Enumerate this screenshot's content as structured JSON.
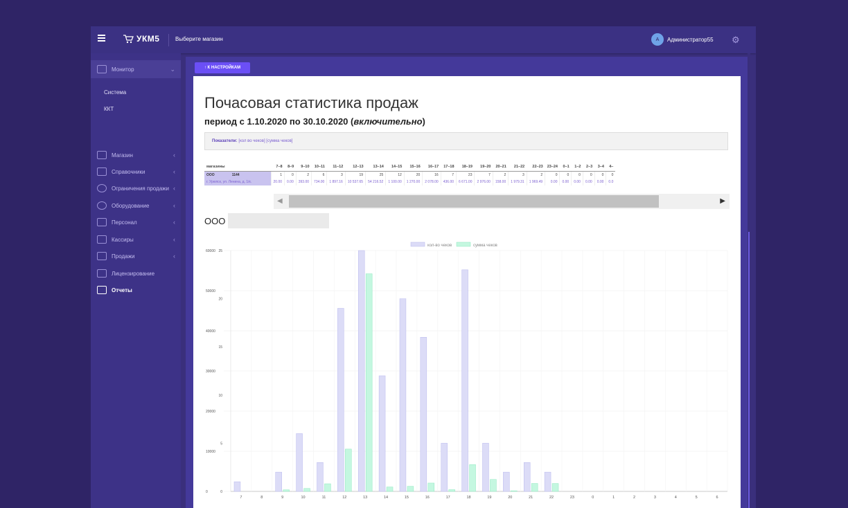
{
  "app": {
    "logo_text": "УКМ5",
    "shop_select": "Выберите магазин",
    "user": "Администратор55",
    "avatar_letter": "A"
  },
  "sidebar": {
    "items": [
      {
        "label": "Монитор",
        "icon": "grid-icon"
      },
      {
        "label": "Магазин",
        "icon": "shop-icon"
      },
      {
        "label": "Справочники",
        "icon": "list-icon"
      },
      {
        "label": "Ограничения продажи",
        "icon": "restrict-icon"
      },
      {
        "label": "Оборудование",
        "icon": "gear-icon"
      },
      {
        "label": "Персонал",
        "icon": "user-icon"
      },
      {
        "label": "Кассиры",
        "icon": "dots-grid-icon"
      },
      {
        "label": "Продажи",
        "icon": "bar-chart-icon"
      },
      {
        "label": "Лицензирование",
        "icon": "lock-icon"
      },
      {
        "label": "Отчеты",
        "icon": "edit-icon"
      }
    ],
    "monitor_sub": [
      "Система",
      "ККТ"
    ]
  },
  "toolbar": {
    "back_label": "К НАСТРОЙКАМ"
  },
  "report": {
    "title": "Почасовая статистика продаж",
    "period_prefix": "период с 1.10.2020 по 30.10.2020 (",
    "period_em": "включительно",
    "period_suffix": ")",
    "indicators_label": "Показатели:",
    "indicators_value": "[кол во чеков] [сумма чеков]",
    "org_name": "ООО"
  },
  "table": {
    "shop_header": "магазины",
    "hours": [
      "7–8",
      "8–9",
      "9–10",
      "10–11",
      "11–12",
      "12–13",
      "13–14",
      "14–15",
      "15–16",
      "16–17",
      "17–18",
      "18–19",
      "19–20",
      "20–21",
      "21–22",
      "22–23",
      "23–24",
      "0–1",
      "1–2",
      "2–3",
      "3–4",
      "4–"
    ],
    "shop_name": "ООО",
    "shop_code": "1144",
    "shop_address": "г. Урюпск, ул. Ленина, д. 1/к.",
    "counts": [
      "1",
      "0",
      "2",
      "6",
      "3",
      "19",
      "25",
      "12",
      "20",
      "16",
      "7",
      "23",
      "7",
      "2",
      "3",
      "2",
      "0",
      "0",
      "0",
      "0",
      "0",
      "0"
    ],
    "sums": [
      "20.00",
      "0.00",
      "393.00",
      "734.00",
      "1 897.16",
      "10 537.65",
      "54 216.52",
      "1 100.00",
      "1 270.00",
      "2 078.00",
      "436.00",
      "6 671.00",
      "2 976.00",
      "158.00",
      "1 979.31",
      "1 969.49",
      "0.00",
      "0.00",
      "0.00",
      "0.00",
      "0.00",
      "0.0"
    ]
  },
  "chart_data": {
    "type": "bar",
    "legend": [
      "кол-во чеков",
      "сумма чеков"
    ],
    "legend_position": "top",
    "categories": [
      "7",
      "8",
      "9",
      "10",
      "11",
      "12",
      "13",
      "14",
      "15",
      "16",
      "17",
      "18",
      "19",
      "20",
      "21",
      "22",
      "23",
      "0",
      "1",
      "2",
      "3",
      "4",
      "5",
      "6"
    ],
    "series": [
      {
        "name": "кол-во чеков",
        "axis": "right",
        "values": [
          1,
          0,
          2,
          6,
          3,
          19,
          25,
          12,
          20,
          16,
          5,
          23,
          5,
          2,
          3,
          2,
          0,
          0,
          0,
          0,
          0,
          0,
          0,
          0
        ]
      },
      {
        "name": "сумма чеков",
        "axis": "left",
        "values": [
          0,
          0,
          393,
          734,
          1897,
          10538,
          54217,
          1100,
          1270,
          2078,
          436,
          6671,
          2976,
          158,
          1979,
          1969,
          0,
          0,
          0,
          0,
          0,
          0,
          0,
          0
        ]
      }
    ],
    "ylim_left": [
      0,
      60000
    ],
    "yticks_left": [
      "0",
      "10000",
      "20000",
      "30000",
      "40000",
      "50000",
      "60000"
    ],
    "ylim_right": [
      0,
      25
    ],
    "yticks_right": [
      "0",
      "5",
      "10",
      "15",
      "20",
      "25"
    ],
    "colors": {
      "count": "#dcdcf7",
      "count_border": "#b8b8ee",
      "sum": "#c4f7e0",
      "sum_border": "#8fe8c0"
    },
    "grid": true
  }
}
